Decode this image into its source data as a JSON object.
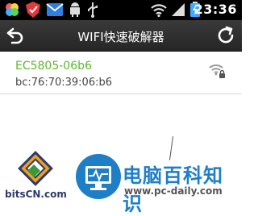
{
  "status_bar": {
    "time": "23:36",
    "icons": [
      "colorful-app-icon",
      "shield-app-icon",
      "mail-icon",
      "android-icon",
      "usb-icon",
      "wifi-icon",
      "signal-icon",
      "battery-charging-icon"
    ]
  },
  "title_bar": {
    "title": "WIFI快速破解器",
    "left_button_icon": "back-icon",
    "right_button_icon": "refresh-icon"
  },
  "networks": [
    {
      "ssid": "EC5805-06b6",
      "mac": "bc:76:70:39:06:b6",
      "secured": true,
      "signal_icon": "wifi-lock-icon"
    }
  ],
  "watermark": {
    "left_text": "bitsCN.com",
    "right_title": "电脑百科知识",
    "right_url": "www.pc-daily.com"
  },
  "colors": {
    "ssid": "#5ab92a",
    "title_bar": "#2f2f2f",
    "status_bar": "#000000",
    "watermark_blue": "#1e7fc7"
  }
}
